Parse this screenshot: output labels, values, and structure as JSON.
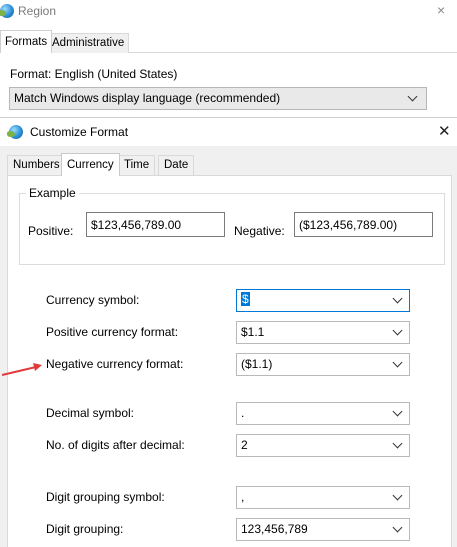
{
  "region": {
    "title": "Region",
    "close_glyph": "×",
    "tabs": [
      {
        "label": "Formats"
      },
      {
        "label": "Administrative"
      }
    ],
    "format_label": "Format: English (United States)",
    "language_select_value": "Match Windows display language (recommended)"
  },
  "customize": {
    "title": "Customize Format",
    "close_glyph": "✕",
    "tabs": [
      {
        "label": "Numbers"
      },
      {
        "label": "Currency",
        "active": true
      },
      {
        "label": "Time"
      },
      {
        "label": "Date"
      }
    ],
    "example": {
      "legend": "Example",
      "positive_label": "Positive:",
      "positive_value": "$123,456,789.00",
      "negative_label": "Negative:",
      "negative_value": "($123,456,789.00)"
    },
    "settings": [
      {
        "label": "Currency symbol:",
        "value": "$"
      },
      {
        "label": "Positive currency format:",
        "value": "$1.1"
      },
      {
        "label": "Negative currency format:",
        "value": "($1.1)"
      },
      {
        "label": "Decimal symbol:",
        "value": "."
      },
      {
        "label": "No. of digits after decimal:",
        "value": "2"
      },
      {
        "label": "Digit grouping symbol:",
        "value": ","
      },
      {
        "label": "Digit grouping:",
        "value": "123,456,789"
      }
    ]
  },
  "colors": {
    "accent": "#0078d7",
    "annotation_arrow": "#e03a3a"
  }
}
